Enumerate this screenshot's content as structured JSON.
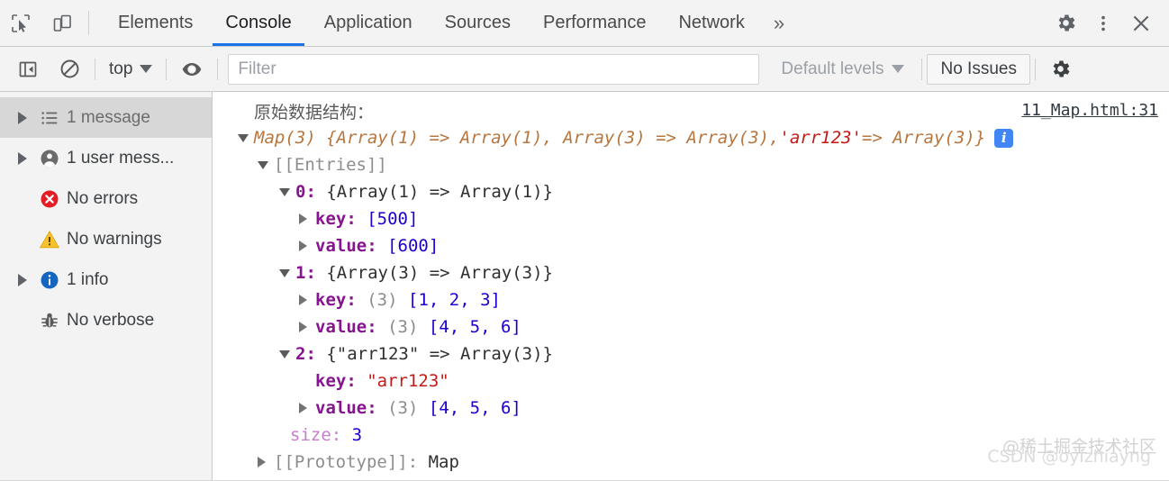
{
  "tabbar": {
    "inspect_icon": "inspect-cursor-icon",
    "device_icon": "device-toolbar-icon",
    "tabs": [
      {
        "label": "Elements",
        "active": false
      },
      {
        "label": "Console",
        "active": true
      },
      {
        "label": "Application",
        "active": false
      },
      {
        "label": "Sources",
        "active": false
      },
      {
        "label": "Performance",
        "active": false
      },
      {
        "label": "Network",
        "active": false
      }
    ],
    "more_label": "»",
    "settings_icon": "gear-icon",
    "menu_icon": "kebab-menu-icon",
    "close_icon": "close-icon"
  },
  "console_toolbar": {
    "sidebar_toggle_icon": "sidebar-toggle-icon",
    "clear_icon": "clear-console-icon",
    "context_label": "top",
    "eye_icon": "live-expression-eye-icon",
    "filter_placeholder": "Filter",
    "filter_value": "",
    "levels_label": "Default levels",
    "issues_label": "No Issues",
    "settings_icon": "gear-icon"
  },
  "sidebar": {
    "items": [
      {
        "label": "1 message",
        "icon": "list-icon",
        "twisty": "closed",
        "selected": true
      },
      {
        "label": "1 user mess...",
        "icon": "user-icon",
        "twisty": "closed",
        "selected": false
      },
      {
        "label": "No errors",
        "icon": "error-icon",
        "twisty": "none",
        "selected": false
      },
      {
        "label": "No warnings",
        "icon": "warning-icon",
        "twisty": "none",
        "selected": false
      },
      {
        "label": "1 info",
        "icon": "info-icon",
        "twisty": "closed",
        "selected": false
      },
      {
        "label": "No verbose",
        "icon": "bug-icon",
        "twisty": "none",
        "selected": false
      }
    ]
  },
  "console": {
    "source_link": "11_Map.html:31",
    "log_text": "原始数据结构：",
    "map_header": {
      "prefix": "Map(3) {Array(1) => Array(1), Array(3) => Array(3), ",
      "string": "'arr123'",
      "suffix": " => Array(3)}"
    },
    "entries_label": "[[Entries]]",
    "rows": [
      {
        "index": "0:",
        "summary": "{Array(1) => Array(1)}"
      },
      {
        "key_label": "key:",
        "value": "[500]"
      },
      {
        "key_label": "value:",
        "value": "[600]"
      },
      {
        "index": "1:",
        "summary": "{Array(3) => Array(3)}"
      },
      {
        "key_label": "key:",
        "count": "(3)",
        "value": "[1, 2, 3]"
      },
      {
        "key_label": "value:",
        "count": "(3)",
        "value": "[4, 5, 6]"
      },
      {
        "index": "2:",
        "summary": "{\"arr123\" => Array(3)}"
      },
      {
        "key_label": "key:",
        "string": "\"arr123\""
      },
      {
        "key_label": "value:",
        "count": "(3)",
        "value": "[4, 5, 6]"
      }
    ],
    "size_label": "size:",
    "size_value": "3",
    "prototype_label": "[[Prototype]]:",
    "prototype_value": "Map",
    "info_badge": "i"
  },
  "watermarks": {
    "primary": "@稀土掘金技术社区",
    "secondary": "CSDN @oyizhiayng"
  },
  "colors": {
    "accent": "#1a73e8",
    "object": "#b8763e",
    "string": "#c41a16",
    "property": "#881391",
    "number": "#1c00cf",
    "gray": "#8d8d8d"
  }
}
